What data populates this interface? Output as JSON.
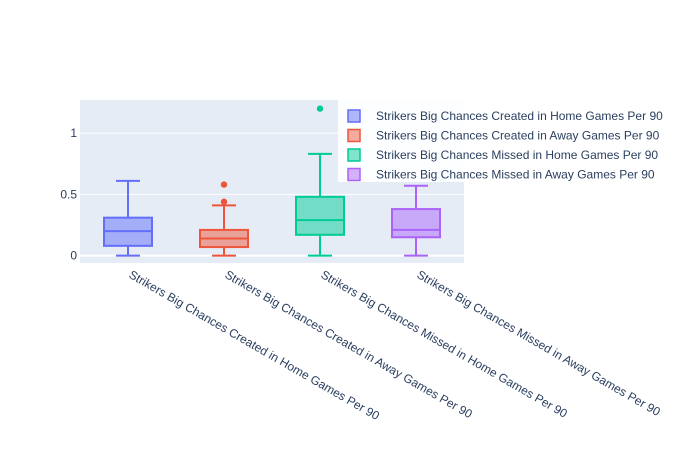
{
  "chart_data": {
    "type": "box",
    "title": "",
    "xlabel": "",
    "ylabel": "",
    "ylim": [
      -0.06,
      1.27
    ],
    "y_ticks": [
      0,
      0.5,
      1
    ],
    "y_tick_labels": [
      "0",
      "0.5",
      "1"
    ],
    "grid": true,
    "legend_position": "top-right",
    "categories": [
      "Strikers Big Chances Created in Home Games Per 90",
      "Strikers Big Chances Created in Away Games Per 90",
      "Strikers Big Chances Missed in Home Games Per 90",
      "Strikers Big Chances Missed in Away Games Per 90"
    ],
    "series": [
      {
        "name": "Strikers Big Chances Created in Home Games Per 90",
        "color": "#636efa",
        "min": 0.0,
        "q1": 0.08,
        "median": 0.2,
        "q3": 0.31,
        "max": 0.61,
        "outliers": []
      },
      {
        "name": "Strikers Big Chances Created in Away Games Per 90",
        "color": "#ef553b",
        "min": 0.0,
        "q1": 0.07,
        "median": 0.14,
        "q3": 0.21,
        "max": 0.41,
        "outliers": [
          0.44,
          0.58
        ]
      },
      {
        "name": "Strikers Big Chances Missed in Home Games Per 90",
        "color": "#00cc96",
        "min": 0.0,
        "q1": 0.17,
        "median": 0.29,
        "q3": 0.48,
        "max": 0.83,
        "outliers": [
          1.2
        ]
      },
      {
        "name": "Strikers Big Chances Missed in Away Games Per 90",
        "color": "#ab63fa",
        "min": 0.0,
        "q1": 0.15,
        "median": 0.21,
        "q3": 0.38,
        "max": 0.57,
        "outliers": []
      }
    ]
  }
}
